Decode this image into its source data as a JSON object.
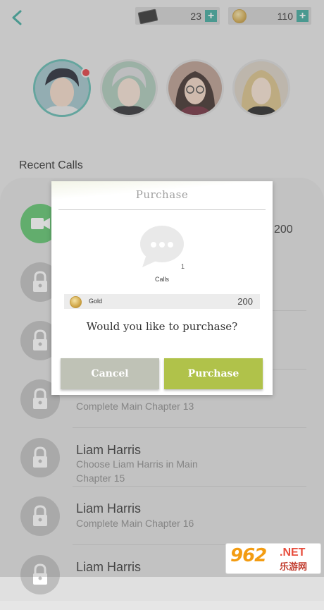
{
  "header": {
    "tickets_value": "23",
    "gold_value": "110",
    "plus_symbol": "+"
  },
  "avatars": [
    {
      "name": "dark-haired-character",
      "selected": true
    },
    {
      "name": "silver-haired-character",
      "selected": false
    },
    {
      "name": "glasses-character",
      "selected": false
    },
    {
      "name": "blonde-character",
      "selected": false
    }
  ],
  "recent_calls": {
    "title": "Recent Calls",
    "rows": [
      {
        "icon": "video-call-icon",
        "price": "200"
      },
      {
        "icon": "lock-icon"
      },
      {
        "icon": "lock-icon"
      },
      {
        "icon": "lock-icon",
        "subtitle": "Complete Main Chapter 13"
      },
      {
        "icon": "lock-icon",
        "name": "Liam Harris",
        "subtitle": "Choose Liam Harris in Main Chapter 15"
      },
      {
        "icon": "lock-icon",
        "name": "Liam Harris",
        "subtitle": "Complete Main Chapter 16"
      },
      {
        "icon": "lock-icon",
        "name": "Liam Harris"
      }
    ]
  },
  "modal": {
    "title": "Purchase",
    "item_icon": "chat-bubble-icon",
    "item_count": "1",
    "item_name": "Calls",
    "currency_label": "Gold",
    "price": "200",
    "question": "Would you like to purchase?",
    "cancel_label": "Cancel",
    "purchase_label": "Purchase"
  },
  "watermark": {
    "number": "962",
    "suffix": ".NET",
    "chinese": "乐游网"
  },
  "colors": {
    "accent_teal": "#3aa79a",
    "call_green": "#5ac36a",
    "purchase_olive": "#b0c24a",
    "cancel_gray": "#bfc2b6"
  }
}
